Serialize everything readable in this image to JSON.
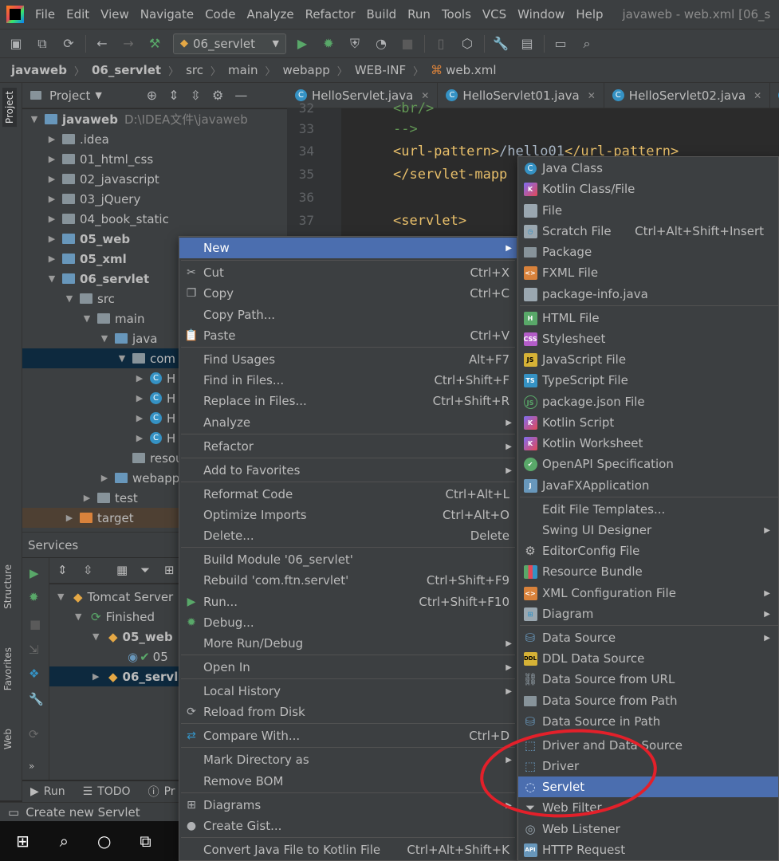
{
  "menubar": {
    "items": [
      "File",
      "Edit",
      "View",
      "Navigate",
      "Code",
      "Analyze",
      "Refactor",
      "Build",
      "Run",
      "Tools",
      "VCS",
      "Window",
      "Help"
    ],
    "window_title": "javaweb - web.xml [06_s"
  },
  "toolbar": {
    "run_config": "06_servlet",
    "icons": [
      "save-icon",
      "save-all-icon",
      "sync-icon",
      "back-icon",
      "forward-icon",
      "hammer-icon",
      "run-icon",
      "debug-icon",
      "coverage-icon",
      "profile-icon",
      "stop-icon",
      "device-icon",
      "box-icon",
      "wrench-icon",
      "structure-icon",
      "terminal-icon",
      "search-icon"
    ]
  },
  "breadcrumb": [
    "javaweb",
    "06_servlet",
    "src",
    "main",
    "webapp",
    "WEB-INF",
    "web.xml"
  ],
  "left_strip": {
    "project": "Project",
    "structure": "Structure",
    "favorites": "Favorites",
    "web": "Web"
  },
  "project_panel": {
    "title": "Project",
    "tree": [
      {
        "label": "javaweb",
        "path": "D:\\IDEA文件\\javaweb",
        "bold": true
      },
      {
        "label": ".idea"
      },
      {
        "label": "01_html_css"
      },
      {
        "label": "02_javascript"
      },
      {
        "label": "03_jQuery"
      },
      {
        "label": "04_book_static"
      },
      {
        "label": "05_web",
        "bold": true
      },
      {
        "label": "05_xml",
        "bold": true
      },
      {
        "label": "06_servlet",
        "bold": true
      },
      {
        "label": "src"
      },
      {
        "label": "main"
      },
      {
        "label": "java"
      },
      {
        "label": "com"
      },
      {
        "label": "H"
      },
      {
        "label": "H"
      },
      {
        "label": "H"
      },
      {
        "label": "H"
      },
      {
        "label": "resourc"
      },
      {
        "label": "webapp"
      },
      {
        "label": "test"
      },
      {
        "label": "target"
      }
    ]
  },
  "services": {
    "title": "Services",
    "tree": [
      {
        "label": "Tomcat Server"
      },
      {
        "label": "Finished"
      },
      {
        "label": "05_web",
        "bold": true
      },
      {
        "label": "05"
      },
      {
        "label": "06_servl",
        "bold": true
      }
    ]
  },
  "bottom_tabs": {
    "run": "Run",
    "todo": "TODO",
    "problems": "Pr"
  },
  "status": "Create new Servlet",
  "editor": {
    "tabs": [
      "HelloServlet.java",
      "HelloServlet01.java",
      "HelloServlet02.java"
    ],
    "line_numbers": [
      "32",
      "33",
      "34",
      "35",
      "36",
      "37"
    ],
    "lines": [
      {
        "tag": "",
        "text": "<br/>",
        "cls": "cm"
      },
      {
        "tag": "",
        "text": "-->",
        "cls": "cm"
      },
      {
        "tag": "<url-pattern>",
        "text": "/hello01",
        "close": "</url-pattern>"
      },
      {
        "tag": "</servlet-mapp",
        "text": "",
        "close": ""
      },
      {
        "tag": "",
        "text": "",
        "close": ""
      },
      {
        "tag": "<servlet>",
        "text": "",
        "close": ""
      }
    ]
  },
  "context_menu": [
    {
      "label": "New",
      "shortcut": "",
      "submenu": true,
      "icon": "",
      "hl": true
    },
    {
      "label": "Cut",
      "shortcut": "Ctrl+X",
      "icon": "✂"
    },
    {
      "label": "Copy",
      "shortcut": "Ctrl+C",
      "icon": "❐"
    },
    {
      "label": "Copy Path...",
      "shortcut": "",
      "icon": ""
    },
    {
      "label": "Paste",
      "shortcut": "Ctrl+V",
      "icon": "📋"
    },
    {
      "label": "Find Usages",
      "shortcut": "Alt+F7",
      "icon": ""
    },
    {
      "label": "Find in Files...",
      "shortcut": "Ctrl+Shift+F",
      "icon": ""
    },
    {
      "label": "Replace in Files...",
      "shortcut": "Ctrl+Shift+R",
      "icon": ""
    },
    {
      "label": "Analyze",
      "shortcut": "",
      "submenu": true,
      "icon": ""
    },
    {
      "label": "Refactor",
      "shortcut": "",
      "submenu": true,
      "icon": ""
    },
    {
      "label": "Add to Favorites",
      "shortcut": "",
      "submenu": true,
      "icon": ""
    },
    {
      "label": "Reformat Code",
      "shortcut": "Ctrl+Alt+L",
      "icon": ""
    },
    {
      "label": "Optimize Imports",
      "shortcut": "Ctrl+Alt+O",
      "icon": ""
    },
    {
      "label": "Delete...",
      "shortcut": "Delete",
      "icon": ""
    },
    {
      "label": "Build Module '06_servlet'",
      "shortcut": "",
      "icon": ""
    },
    {
      "label": "Rebuild 'com.ftn.servlet'",
      "shortcut": "Ctrl+Shift+F9",
      "icon": ""
    },
    {
      "label": "Run...",
      "shortcut": "Ctrl+Shift+F10",
      "icon": "▶"
    },
    {
      "label": "Debug...",
      "shortcut": "",
      "icon": "✹"
    },
    {
      "label": "More Run/Debug",
      "shortcut": "",
      "submenu": true,
      "icon": ""
    },
    {
      "label": "Open In",
      "shortcut": "",
      "submenu": true,
      "icon": ""
    },
    {
      "label": "Local History",
      "shortcut": "",
      "submenu": true,
      "icon": ""
    },
    {
      "label": "Reload from Disk",
      "shortcut": "",
      "icon": "⟳"
    },
    {
      "label": "Compare With...",
      "shortcut": "Ctrl+D",
      "icon": "⇄"
    },
    {
      "label": "Mark Directory as",
      "shortcut": "",
      "submenu": true,
      "icon": ""
    },
    {
      "label": "Remove BOM",
      "shortcut": "",
      "icon": ""
    },
    {
      "label": "Diagrams",
      "shortcut": "",
      "submenu": true,
      "icon": "⊞"
    },
    {
      "label": "Create Gist...",
      "shortcut": "",
      "icon": "●"
    },
    {
      "label": "Convert Java File to Kotlin File",
      "shortcut": "Ctrl+Alt+Shift+K",
      "icon": ""
    }
  ],
  "new_submenu": [
    {
      "label": "Java Class",
      "shortcut": ""
    },
    {
      "label": "Kotlin Class/File",
      "shortcut": ""
    },
    {
      "label": "File",
      "shortcut": ""
    },
    {
      "label": "Scratch File",
      "shortcut": "Ctrl+Alt+Shift+Insert"
    },
    {
      "label": "Package",
      "shortcut": ""
    },
    {
      "label": "FXML File",
      "shortcut": ""
    },
    {
      "label": "package-info.java",
      "shortcut": ""
    },
    {
      "label": "HTML File",
      "shortcut": ""
    },
    {
      "label": "Stylesheet",
      "shortcut": ""
    },
    {
      "label": "JavaScript File",
      "shortcut": ""
    },
    {
      "label": "TypeScript File",
      "shortcut": ""
    },
    {
      "label": "package.json File",
      "shortcut": ""
    },
    {
      "label": "Kotlin Script",
      "shortcut": ""
    },
    {
      "label": "Kotlin Worksheet",
      "shortcut": ""
    },
    {
      "label": "OpenAPI Specification",
      "shortcut": ""
    },
    {
      "label": "JavaFXApplication",
      "shortcut": ""
    },
    {
      "label": "Edit File Templates...",
      "shortcut": ""
    },
    {
      "label": "Swing UI Designer",
      "shortcut": "",
      "submenu": true
    },
    {
      "label": "EditorConfig File",
      "shortcut": ""
    },
    {
      "label": "Resource Bundle",
      "shortcut": ""
    },
    {
      "label": "XML Configuration File",
      "shortcut": "",
      "submenu": true
    },
    {
      "label": "Diagram",
      "shortcut": "",
      "submenu": true
    },
    {
      "label": "Data Source",
      "shortcut": "",
      "submenu": true
    },
    {
      "label": "DDL Data Source",
      "shortcut": ""
    },
    {
      "label": "Data Source from URL",
      "shortcut": ""
    },
    {
      "label": "Data Source from Path",
      "shortcut": ""
    },
    {
      "label": "Data Source in Path",
      "shortcut": ""
    },
    {
      "label": "Driver and Data Source",
      "shortcut": ""
    },
    {
      "label": "Driver",
      "shortcut": ""
    },
    {
      "label": "Servlet",
      "shortcut": "",
      "hl": true
    },
    {
      "label": "Web Filter",
      "shortcut": ""
    },
    {
      "label": "Web Listener",
      "shortcut": ""
    },
    {
      "label": "HTTP Request",
      "shortcut": ""
    }
  ],
  "colors": {
    "highlight": "#4b6eaf",
    "annotation": "#e3202a",
    "panel": "#3c3f41",
    "editor": "#2b2b2b"
  }
}
